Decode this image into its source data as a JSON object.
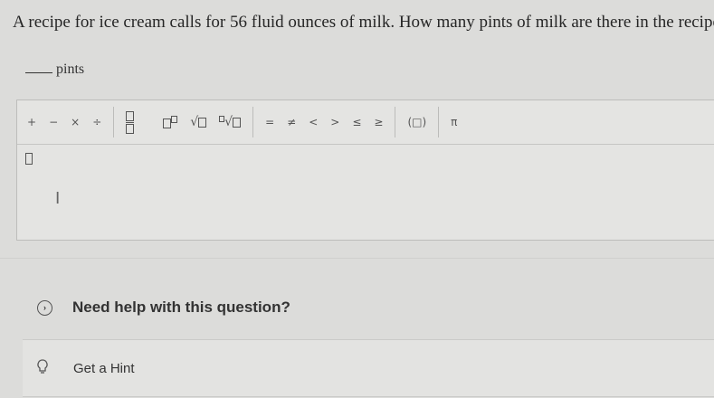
{
  "question": {
    "text": "A recipe for ice cream calls for 56 fluid ounces of milk. How many pints of milk are there in the recipe"
  },
  "answer": {
    "unit_label": "pints"
  },
  "toolbar": {
    "plus": "+",
    "minus": "−",
    "times": "×",
    "divide": "÷",
    "equals": "=",
    "not_equals": "≠",
    "less": "<",
    "greater": ">",
    "leq": "≤",
    "geq": "≥",
    "parens": "(□)",
    "pi": "π"
  },
  "help": {
    "label": "Need help with this question?"
  },
  "hint": {
    "label": "Get a Hint"
  }
}
